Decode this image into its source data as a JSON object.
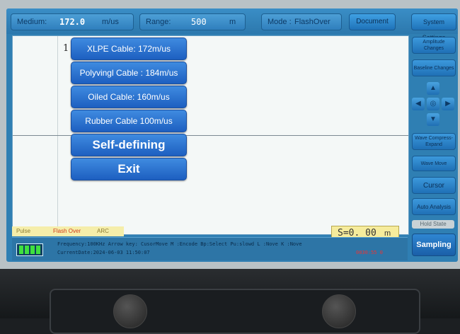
{
  "topbar": {
    "medium_label": "Medium:",
    "medium_value": "172.0",
    "medium_unit": "m/us",
    "range_label": "Range:",
    "range_value": "500",
    "range_unit": "m",
    "mode_label": "Mode :",
    "mode_value": "FlashOver",
    "document": "Document",
    "system_settings": "System Settings"
  },
  "cursor_marker": "1",
  "menu": [
    {
      "label": "XLPE Cable: 172m/us"
    },
    {
      "label": "Polyvingl Cable :  184m/us"
    },
    {
      "label": "Oiled Cable: 160m/us"
    },
    {
      "label": "Rubber Cable 100m/us"
    },
    {
      "label": "Self-defining"
    },
    {
      "label": "Exit"
    }
  ],
  "distance": {
    "value": "S=0. 00",
    "unit": "m"
  },
  "modes": [
    "Pulse",
    "Flash Over",
    "ARC"
  ],
  "status": {
    "line1": "Frequency:100KHz Arrow key:  CusorMove   M :Encode  Bp:Select  Pu:slowd   L :Nove      K :Nove",
    "line2": "CurrentDate:2024-06-03 11:50:07",
    "red_readout": "0030:55 0"
  },
  "sidebar": {
    "amplitude": "Amplitude Changes",
    "baseline": "Baseline Changes",
    "wave_compress": "Wave Compress-Expand",
    "wave_move": "Wave Move",
    "cursor": "Cursor",
    "auto_analysis": "Auto Analysis",
    "hold_state": "Hold State",
    "sampling": "Sampling"
  },
  "icons": {
    "up": "arrow-up-icon",
    "down": "arrow-down-icon",
    "left": "arrow-left-icon",
    "right": "arrow-right-icon",
    "center": "center-icon"
  },
  "colors": {
    "screen_blue": "#2f7fb3",
    "menu_blue": "#1d5fc0",
    "distance_yellow": "#f6ec9c",
    "battery_green": "#3fe03f"
  }
}
